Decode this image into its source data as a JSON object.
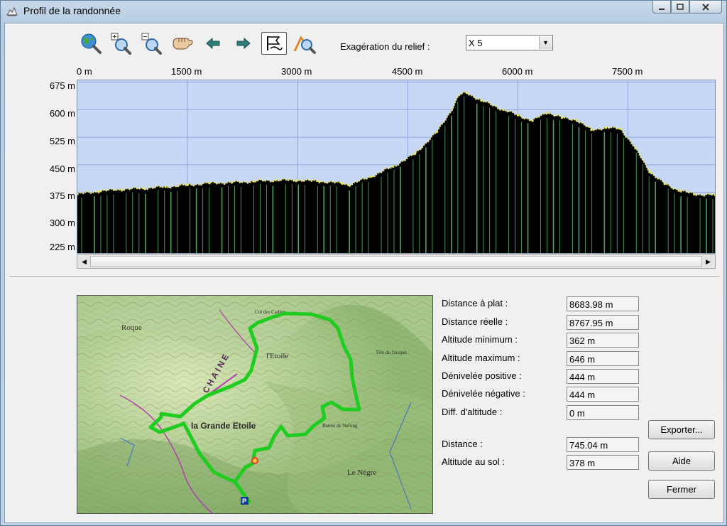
{
  "window": {
    "title": "Profil de la randonnée"
  },
  "toolbar": {
    "tools": [
      {
        "name": "globe-zoom-icon"
      },
      {
        "name": "zoom-in-icon"
      },
      {
        "name": "zoom-out-icon"
      },
      {
        "name": "pan-hand-icon"
      },
      {
        "name": "arrow-left-icon"
      },
      {
        "name": "arrow-right-icon"
      },
      {
        "name": "flag-route-icon",
        "active": true
      },
      {
        "name": "profile-zoom-icon"
      }
    ],
    "relief_label": "Exagération du relief :",
    "relief_value": "X 5"
  },
  "chart_data": {
    "type": "area",
    "x_unit": "m",
    "y_unit": "m",
    "x_ticks": [
      "0 m",
      "1500 m",
      "3000 m",
      "4500 m",
      "6000 m",
      "7500 m"
    ],
    "y_ticks": [
      "675 m",
      "600 m",
      "525 m",
      "450 m",
      "375 m",
      "300 m",
      "225 m"
    ],
    "xlim": [
      0,
      8683.98
    ],
    "ylim": [
      210,
      680
    ],
    "x": [
      0,
      300,
      600,
      900,
      1200,
      1500,
      1800,
      2100,
      2400,
      2700,
      3000,
      3300,
      3600,
      3700,
      4000,
      4300,
      4600,
      4900,
      5100,
      5200,
      5300,
      5500,
      5800,
      6000,
      6200,
      6400,
      6600,
      6800,
      7000,
      7200,
      7400,
      7600,
      7800,
      8000,
      8200,
      8400,
      8683.98
    ],
    "y": [
      370,
      378,
      383,
      386,
      390,
      395,
      400,
      402,
      405,
      408,
      408,
      405,
      400,
      395,
      418,
      445,
      480,
      540,
      600,
      640,
      646,
      625,
      600,
      585,
      570,
      593,
      578,
      572,
      545,
      551,
      548,
      495,
      430,
      398,
      380,
      370,
      368
    ],
    "colors": {
      "sky": "#c6d8f6",
      "grid": "#8fa6dd",
      "terrain": "#000000",
      "stripes": "#4ea25f",
      "ridge": "#e8e050"
    }
  },
  "stats": [
    {
      "label": "Distance à plat :",
      "value": "8683.98 m"
    },
    {
      "label": "Distance réelle :",
      "value": "8767.95 m"
    },
    {
      "label": "Altitude minimum :",
      "value": "362 m"
    },
    {
      "label": "Altitude maximum :",
      "value": "646 m"
    },
    {
      "label": "Dénivelée positive :",
      "value": "444 m"
    },
    {
      "label": "Dénivelée négative :",
      "value": "444 m"
    },
    {
      "label": "Diff. d'altitude :",
      "value": "0 m"
    },
    {
      "label": "Distance :",
      "value": "745.04 m"
    },
    {
      "label": "Altitude au sol :",
      "value": "378 m"
    }
  ],
  "buttons": {
    "export": "Exporter...",
    "help": "Aide",
    "close": "Fermer"
  },
  "map": {
    "labels": [
      "Roque",
      "CHAINE",
      "l'Etoile",
      "la Grande Etoile",
      "Col des Cadiers",
      "Tête du Jacquet",
      "Barres de Nafong",
      "Le Nègre",
      "P"
    ]
  }
}
